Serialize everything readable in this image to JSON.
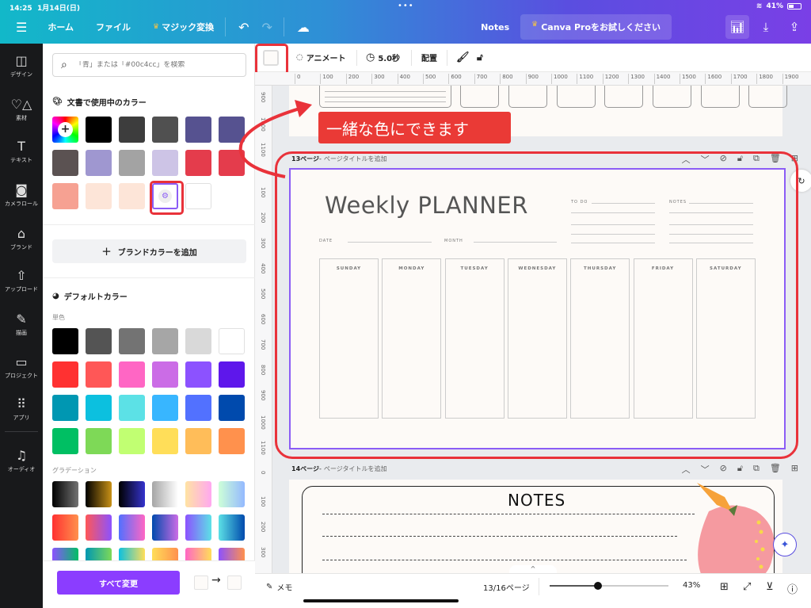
{
  "status_bar": {
    "time": "14:25",
    "date": "1月14日(日)",
    "battery": "41%",
    "battery_level": 0.41
  },
  "topbar": {
    "menu_icon": "hamburger-icon",
    "home": "ホーム",
    "file": "ファイル",
    "magic": "マジック変換",
    "doc_title": "Notes",
    "pro_cta": "Canva Proをお試しください",
    "icons": {
      "undo": "undo-icon",
      "redo": "redo-icon",
      "cloud": "cloud-saved-icon",
      "insights": "bar-chart-icon",
      "download": "download-icon",
      "share": "share-icon"
    }
  },
  "sidebar": {
    "items": [
      {
        "label": "デザイン",
        "icon": "design-icon"
      },
      {
        "label": "素材",
        "icon": "elements-icon"
      },
      {
        "label": "テキスト",
        "icon": "text-icon"
      },
      {
        "label": "カメラロール",
        "icon": "camera-icon"
      },
      {
        "label": "ブランド",
        "icon": "brand-icon"
      },
      {
        "label": "アップロード",
        "icon": "upload-icon"
      },
      {
        "label": "描画",
        "icon": "draw-icon"
      },
      {
        "label": "プロジェクト",
        "icon": "folder-icon"
      },
      {
        "label": "アプリ",
        "icon": "apps-icon"
      },
      {
        "label": "オーディオ",
        "icon": "audio-icon"
      }
    ]
  },
  "color_panel": {
    "search_placeholder": "「青」または「#00c4cc」を検索",
    "doc_colors_title": "文書で使用中のカラー",
    "doc_colors": [
      "#000000",
      "#3d3d3d",
      "#505050",
      "#565290",
      "#565290",
      "#5b5252",
      "#9f97d0",
      "#a3a3a3",
      "#cdc4e6",
      "#e43c4c",
      "#e43c4c",
      "#f6a192",
      "#fde5d8",
      "#fde5d8",
      "custom",
      "#ffffff"
    ],
    "add_brand_color": "ブランドカラーを追加",
    "default_colors_title": "デフォルトカラー",
    "solid_label": "単色",
    "solid_colors": [
      "#000000",
      "#545454",
      "#737373",
      "#a6a6a6",
      "#d9d9d9",
      "#ffffff",
      "#ff3131",
      "#ff5757",
      "#ff66c4",
      "#cb6ce6",
      "#8c52ff",
      "#5e17eb",
      "#0097b2",
      "#0cc0df",
      "#5ce1e6",
      "#38b6ff",
      "#5271ff",
      "#004aad",
      "#00bf63",
      "#7ed957",
      "#c1ff72",
      "#ffde59",
      "#ffbd59",
      "#ff914d"
    ],
    "gradient_label": "グラデーション",
    "gradients": [
      [
        "#000000",
        "#737373"
      ],
      [
        "#000000",
        "#c89116"
      ],
      [
        "#000000",
        "#3533cd"
      ],
      [
        "#a6a6a6",
        "#ffffff"
      ],
      [
        "#ffe3a3",
        "#ffa8f0"
      ],
      [
        "#cdffd8",
        "#94b9ff"
      ],
      [
        "#ff3131",
        "#ff914d"
      ],
      [
        "#ff5757",
        "#8c52ff"
      ],
      [
        "#5170ff",
        "#ff66c4"
      ],
      [
        "#004aad",
        "#cb6ce6"
      ],
      [
        "#8c52ff",
        "#5ce1e6"
      ],
      [
        "#5ce1e6",
        "#004aad"
      ],
      [
        "#8c52ff",
        "#00bf63"
      ],
      [
        "#0097b2",
        "#7ed957"
      ],
      [
        "#0cc0df",
        "#ffde59"
      ],
      [
        "#ffde59",
        "#ff914d"
      ],
      [
        "#ff66c4",
        "#ffde59"
      ],
      [
        "#8c52ff",
        "#ff914d"
      ]
    ],
    "apply_all": "すべて変更",
    "from_color": "#fdfbf9",
    "to_color": "#fdfbf9"
  },
  "toolbar": {
    "animate": "アニメート",
    "duration": "5.0秒",
    "position": "配置"
  },
  "ruler": {
    "h": [
      "0",
      "100",
      "200",
      "300",
      "400",
      "500",
      "600",
      "700",
      "800",
      "900",
      "1000",
      "1100",
      "1200",
      "1300",
      "1400",
      "1500",
      "1600",
      "1700",
      "1800",
      "1900"
    ],
    "v_top": [
      "900",
      "1000",
      "1100"
    ],
    "v_mid": [
      "100",
      "200",
      "300",
      "400",
      "500",
      "600",
      "700",
      "800",
      "900",
      "1000",
      "1100"
    ],
    "v_bot": [
      "0",
      "100",
      "200",
      "300"
    ]
  },
  "annotation": {
    "callout": "一緒な色にできます",
    "color": "#ea3a36"
  },
  "pages": {
    "p13": {
      "num": "13ページ",
      "sep": " - ",
      "title_placeholder": "ページタイトルを追加"
    },
    "p14": {
      "num": "14ページ",
      "sep": " - ",
      "title_placeholder": "ページタイトルを追加"
    }
  },
  "planner": {
    "title": "Weekly PLANNER",
    "todo": "TO DO",
    "notes": "NOTES",
    "date": "DATE",
    "month": "MONTH",
    "days": [
      "SUNDAY",
      "MONDAY",
      "TUESDAY",
      "WEDNESDAY",
      "THURSDAY",
      "FRIDAY",
      "SATURDAY"
    ]
  },
  "notes_page": {
    "title": "NOTES"
  },
  "bottombar": {
    "memo": "メモ",
    "page_indicator": "13/16ページ",
    "zoom": "43%",
    "zoom_fraction": 0.43
  }
}
